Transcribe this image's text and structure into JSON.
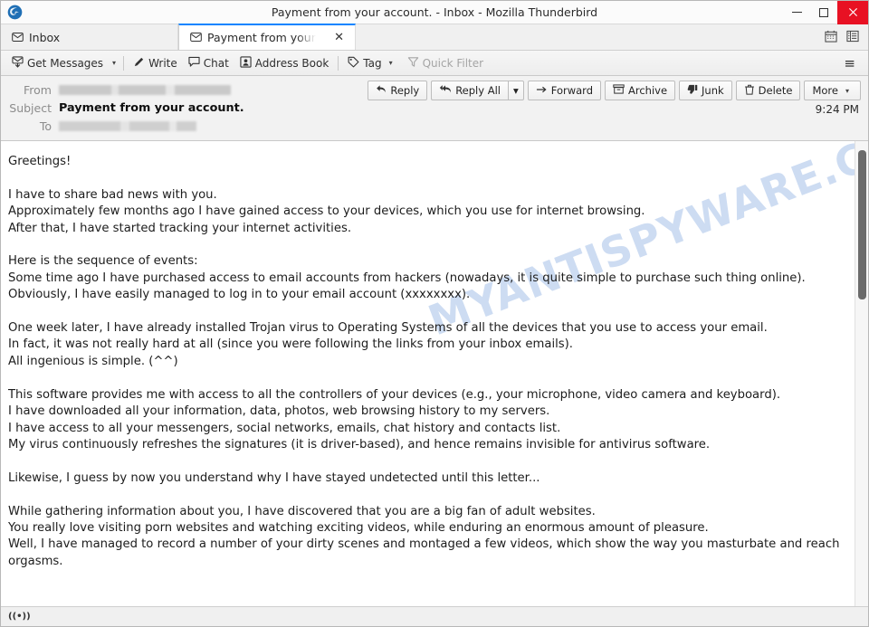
{
  "window": {
    "title": "Payment from your account. - Inbox - Mozilla Thunderbird",
    "logo_icon": "thunderbird-logo-icon",
    "minimize_label": "Minimize",
    "maximize_label": "Maximize",
    "close_label": "Close"
  },
  "tabs": [
    {
      "label": "Inbox",
      "icon": "envelope-icon",
      "active": false
    },
    {
      "label": "Payment from your ac",
      "icon": "envelope-icon",
      "active": true,
      "close_label": "✕"
    }
  ],
  "tabbar_right": {
    "calendar_icon": "calendar-icon",
    "tasks_icon": "task-list-icon"
  },
  "toolbar": {
    "get_messages": "Get Messages",
    "get_messages_icon": "download-mail-icon",
    "get_messages_caret": "▾",
    "write": "Write",
    "write_icon": "pencil-icon",
    "chat": "Chat",
    "chat_icon": "speech-bubble-icon",
    "address_book": "Address Book",
    "address_book_icon": "address-book-icon",
    "tag": "Tag",
    "tag_icon": "tag-icon",
    "tag_caret": "▾",
    "quick_filter": "Quick Filter",
    "quick_filter_icon": "funnel-icon",
    "menu_icon": "hamburger-menu-icon",
    "menu_glyph": "≡"
  },
  "message": {
    "from_label": "From",
    "from_value": "",
    "subject_label": "Subject",
    "subject_value": "Payment from your account.",
    "to_label": "To",
    "to_value": "",
    "time": "9:24 PM",
    "actions": {
      "reply": "Reply",
      "reply_icon": "reply-arrow-icon",
      "reply_all": "Reply All",
      "reply_all_icon": "reply-all-arrow-icon",
      "reply_all_caret": "▾",
      "forward": "Forward",
      "forward_icon": "forward-arrow-icon",
      "archive": "Archive",
      "archive_icon": "archive-box-icon",
      "junk": "Junk",
      "junk_icon": "thumbs-down-icon",
      "delete": "Delete",
      "delete_icon": "trash-can-icon",
      "more": "More",
      "more_caret": "▾"
    }
  },
  "body": {
    "watermark": "MYANTISPYWARE.COM",
    "text": "Greetings!\n\nI have to share bad news with you.\nApproximately few months ago I have gained access to your devices, which you use for internet browsing.\nAfter that, I have started tracking your internet activities.\n\nHere is the sequence of events:\nSome time ago I have purchased access to email accounts from hackers (nowadays, it is quite simple to purchase such thing online).\nObviously, I have easily managed to log in to your email account (xxxxxxxx).\n\nOne week later, I have already installed Trojan virus to Operating Systems of all the devices that you use to access your email.\nIn fact, it was not really hard at all (since you were following the links from your inbox emails).\nAll ingenious is simple. (^^)\n\nThis software provides me with access to all the controllers of your devices (e.g., your microphone, video camera and keyboard).\nI have downloaded all your information, data, photos, web browsing history to my servers.\nI have access to all your messengers, social networks, emails, chat history and contacts list.\nMy virus continuously refreshes the signatures (it is driver-based), and hence remains invisible for antivirus software.\n\nLikewise, I guess by now you understand why I have stayed undetected until this letter...\n\nWhile gathering information about you, I have discovered that you are a big fan of adult websites.\nYou really love visiting porn websites and watching exciting videos, while enduring an enormous amount of pleasure.\nWell, I have managed to record a number of your dirty scenes and montaged a few videos, which show the way you masturbate and reach orgasms."
  },
  "statusbar": {
    "connection_icon": "connection-signal-icon",
    "connection_glyph": "((•))"
  },
  "colors": {
    "accent": "#0a84ff",
    "close_button": "#e81123",
    "watermark": "#cddcf2",
    "toolbar_bg": "#f2f2f2"
  }
}
